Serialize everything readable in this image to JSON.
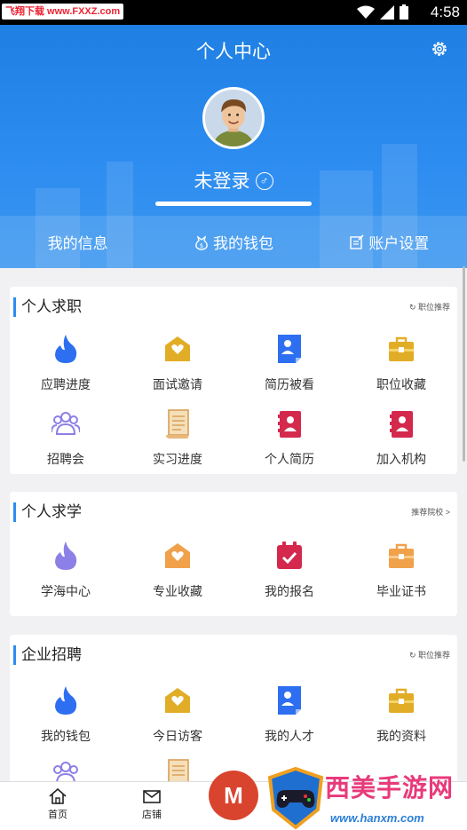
{
  "status": {
    "watermark": "飞翔下载 www.FXXZ.com",
    "time": "4:58"
  },
  "header": {
    "title": "个人中心",
    "username": "未登录",
    "sex_icon": "male-icon",
    "nav": [
      {
        "label": "我的信息"
      },
      {
        "label": "我的钱包",
        "icon": "wallet-icon"
      },
      {
        "label": "账户设置",
        "icon": "edit-icon"
      }
    ]
  },
  "colors": {
    "primary": "#2d8cf0",
    "flame": "#2d6ff0",
    "gold": "#e2ad26",
    "red": "#d4284d",
    "purple": "#8c7fe6",
    "orange": "#f0a14a"
  },
  "job": {
    "title": "个人求职",
    "more": "职位推荐",
    "items": [
      {
        "label": "应聘进度",
        "icon": "flame-icon"
      },
      {
        "label": "面试邀请",
        "icon": "heart-envelope-icon"
      },
      {
        "label": "简历被看",
        "icon": "profile-doc-icon"
      },
      {
        "label": "职位收藏",
        "icon": "briefcase-icon"
      },
      {
        "label": "招聘会",
        "icon": "group-icon"
      },
      {
        "label": "实习进度",
        "icon": "scroll-icon"
      },
      {
        "label": "个人简历",
        "icon": "resume-book-icon"
      },
      {
        "label": "加入机构",
        "icon": "resume-book-icon"
      }
    ]
  },
  "study": {
    "title": "个人求学",
    "more": "推荐院校 >",
    "items": [
      {
        "label": "学海中心",
        "icon": "flame-icon"
      },
      {
        "label": "专业收藏",
        "icon": "heart-envelope-icon"
      },
      {
        "label": "我的报名",
        "icon": "calendar-check-icon"
      },
      {
        "label": "毕业证书",
        "icon": "briefcase-icon"
      }
    ]
  },
  "company": {
    "title": "企业招聘",
    "more": "职位推荐",
    "items": [
      {
        "label": "我的钱包",
        "icon": "flame-icon"
      },
      {
        "label": "今日访客",
        "icon": "heart-envelope-icon"
      },
      {
        "label": "我的人才",
        "icon": "profile-doc-icon"
      },
      {
        "label": "我的资料",
        "icon": "briefcase-icon"
      }
    ]
  },
  "tabbar": [
    {
      "label": "首页",
      "icon": "home-icon"
    },
    {
      "label": "店铺",
      "icon": "mail-icon"
    }
  ],
  "fab": {
    "label": "M"
  },
  "bottom_watermark": {
    "title": "西美手游网",
    "url": "www.hanxm.com",
    "sub": "www.FXXZ.com"
  }
}
